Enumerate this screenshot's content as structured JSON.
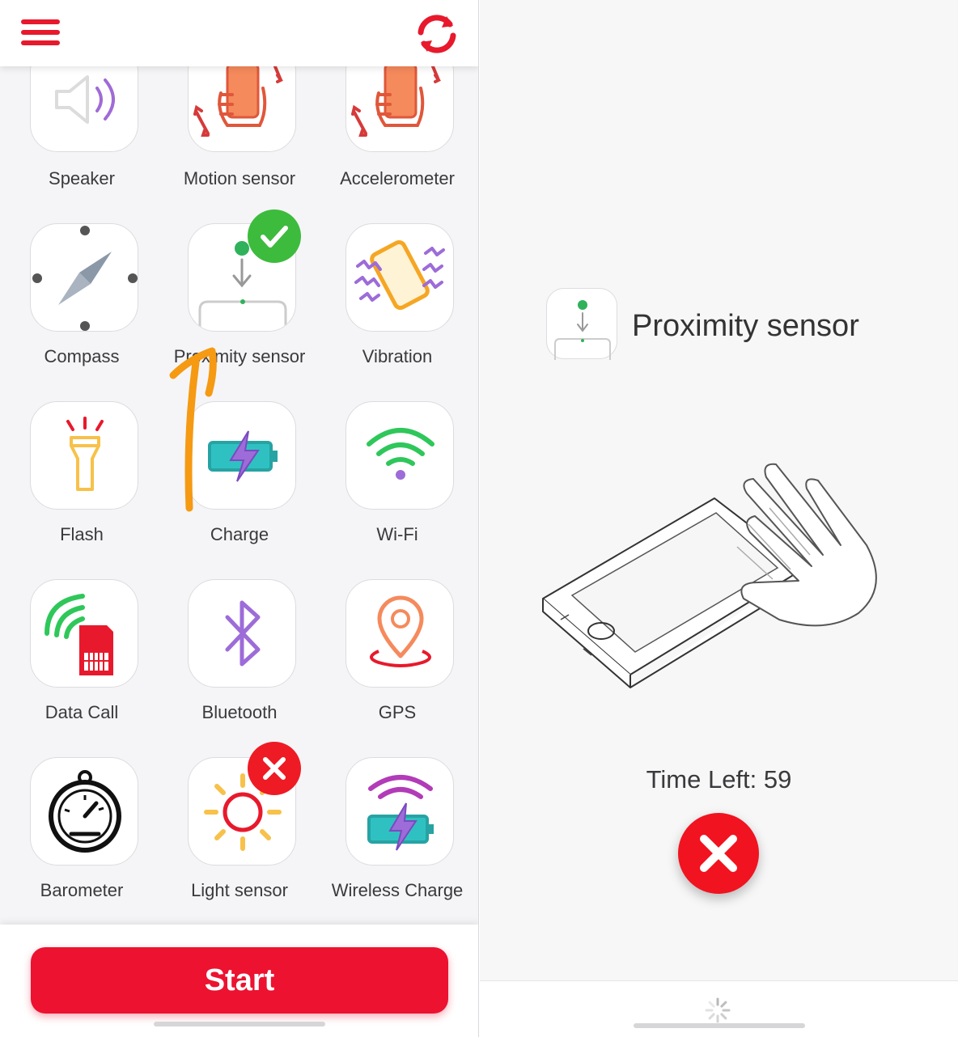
{
  "left_panel": {
    "header": {
      "menu_icon": "hamburger-icon",
      "refresh_icon": "refresh-icon"
    },
    "tests": [
      {
        "label": "Speaker",
        "icon": "speaker-icon",
        "status": "none"
      },
      {
        "label": "Motion sensor",
        "icon": "motion-sensor-icon",
        "status": "none"
      },
      {
        "label": "Accelerometer",
        "icon": "accelerometer-icon",
        "status": "none"
      },
      {
        "label": "Compass",
        "icon": "compass-icon",
        "status": "none"
      },
      {
        "label": "Proximity sensor",
        "icon": "proximity-sensor-icon",
        "status": "passed"
      },
      {
        "label": "Vibration",
        "icon": "vibration-icon",
        "status": "none"
      },
      {
        "label": "Flash",
        "icon": "flashlight-icon",
        "status": "none"
      },
      {
        "label": "Charge",
        "icon": "battery-charge-icon",
        "status": "none"
      },
      {
        "label": "Wi-Fi",
        "icon": "wifi-icon",
        "status": "none"
      },
      {
        "label": "Data Call",
        "icon": "sim-card-icon",
        "status": "none"
      },
      {
        "label": "Bluetooth",
        "icon": "bluetooth-icon",
        "status": "none"
      },
      {
        "label": "GPS",
        "icon": "location-pin-icon",
        "status": "none"
      },
      {
        "label": "Barometer",
        "icon": "barometer-icon",
        "status": "none"
      },
      {
        "label": "Light sensor",
        "icon": "sun-icon",
        "status": "failed"
      },
      {
        "label": "Wireless Charge",
        "icon": "wireless-charge-icon",
        "status": "none"
      }
    ],
    "start_button": "Start"
  },
  "right_panel": {
    "sensor_title": "Proximity sensor",
    "time_left": "Time Left: 59",
    "cancel_icon": "close-icon",
    "loading_icon": "spinner-icon"
  },
  "colors": {
    "brand_red": "#ec1230",
    "success_green": "#3dbb3d",
    "fail_red": "#f1131f",
    "annotation_orange": "#f59a12"
  }
}
